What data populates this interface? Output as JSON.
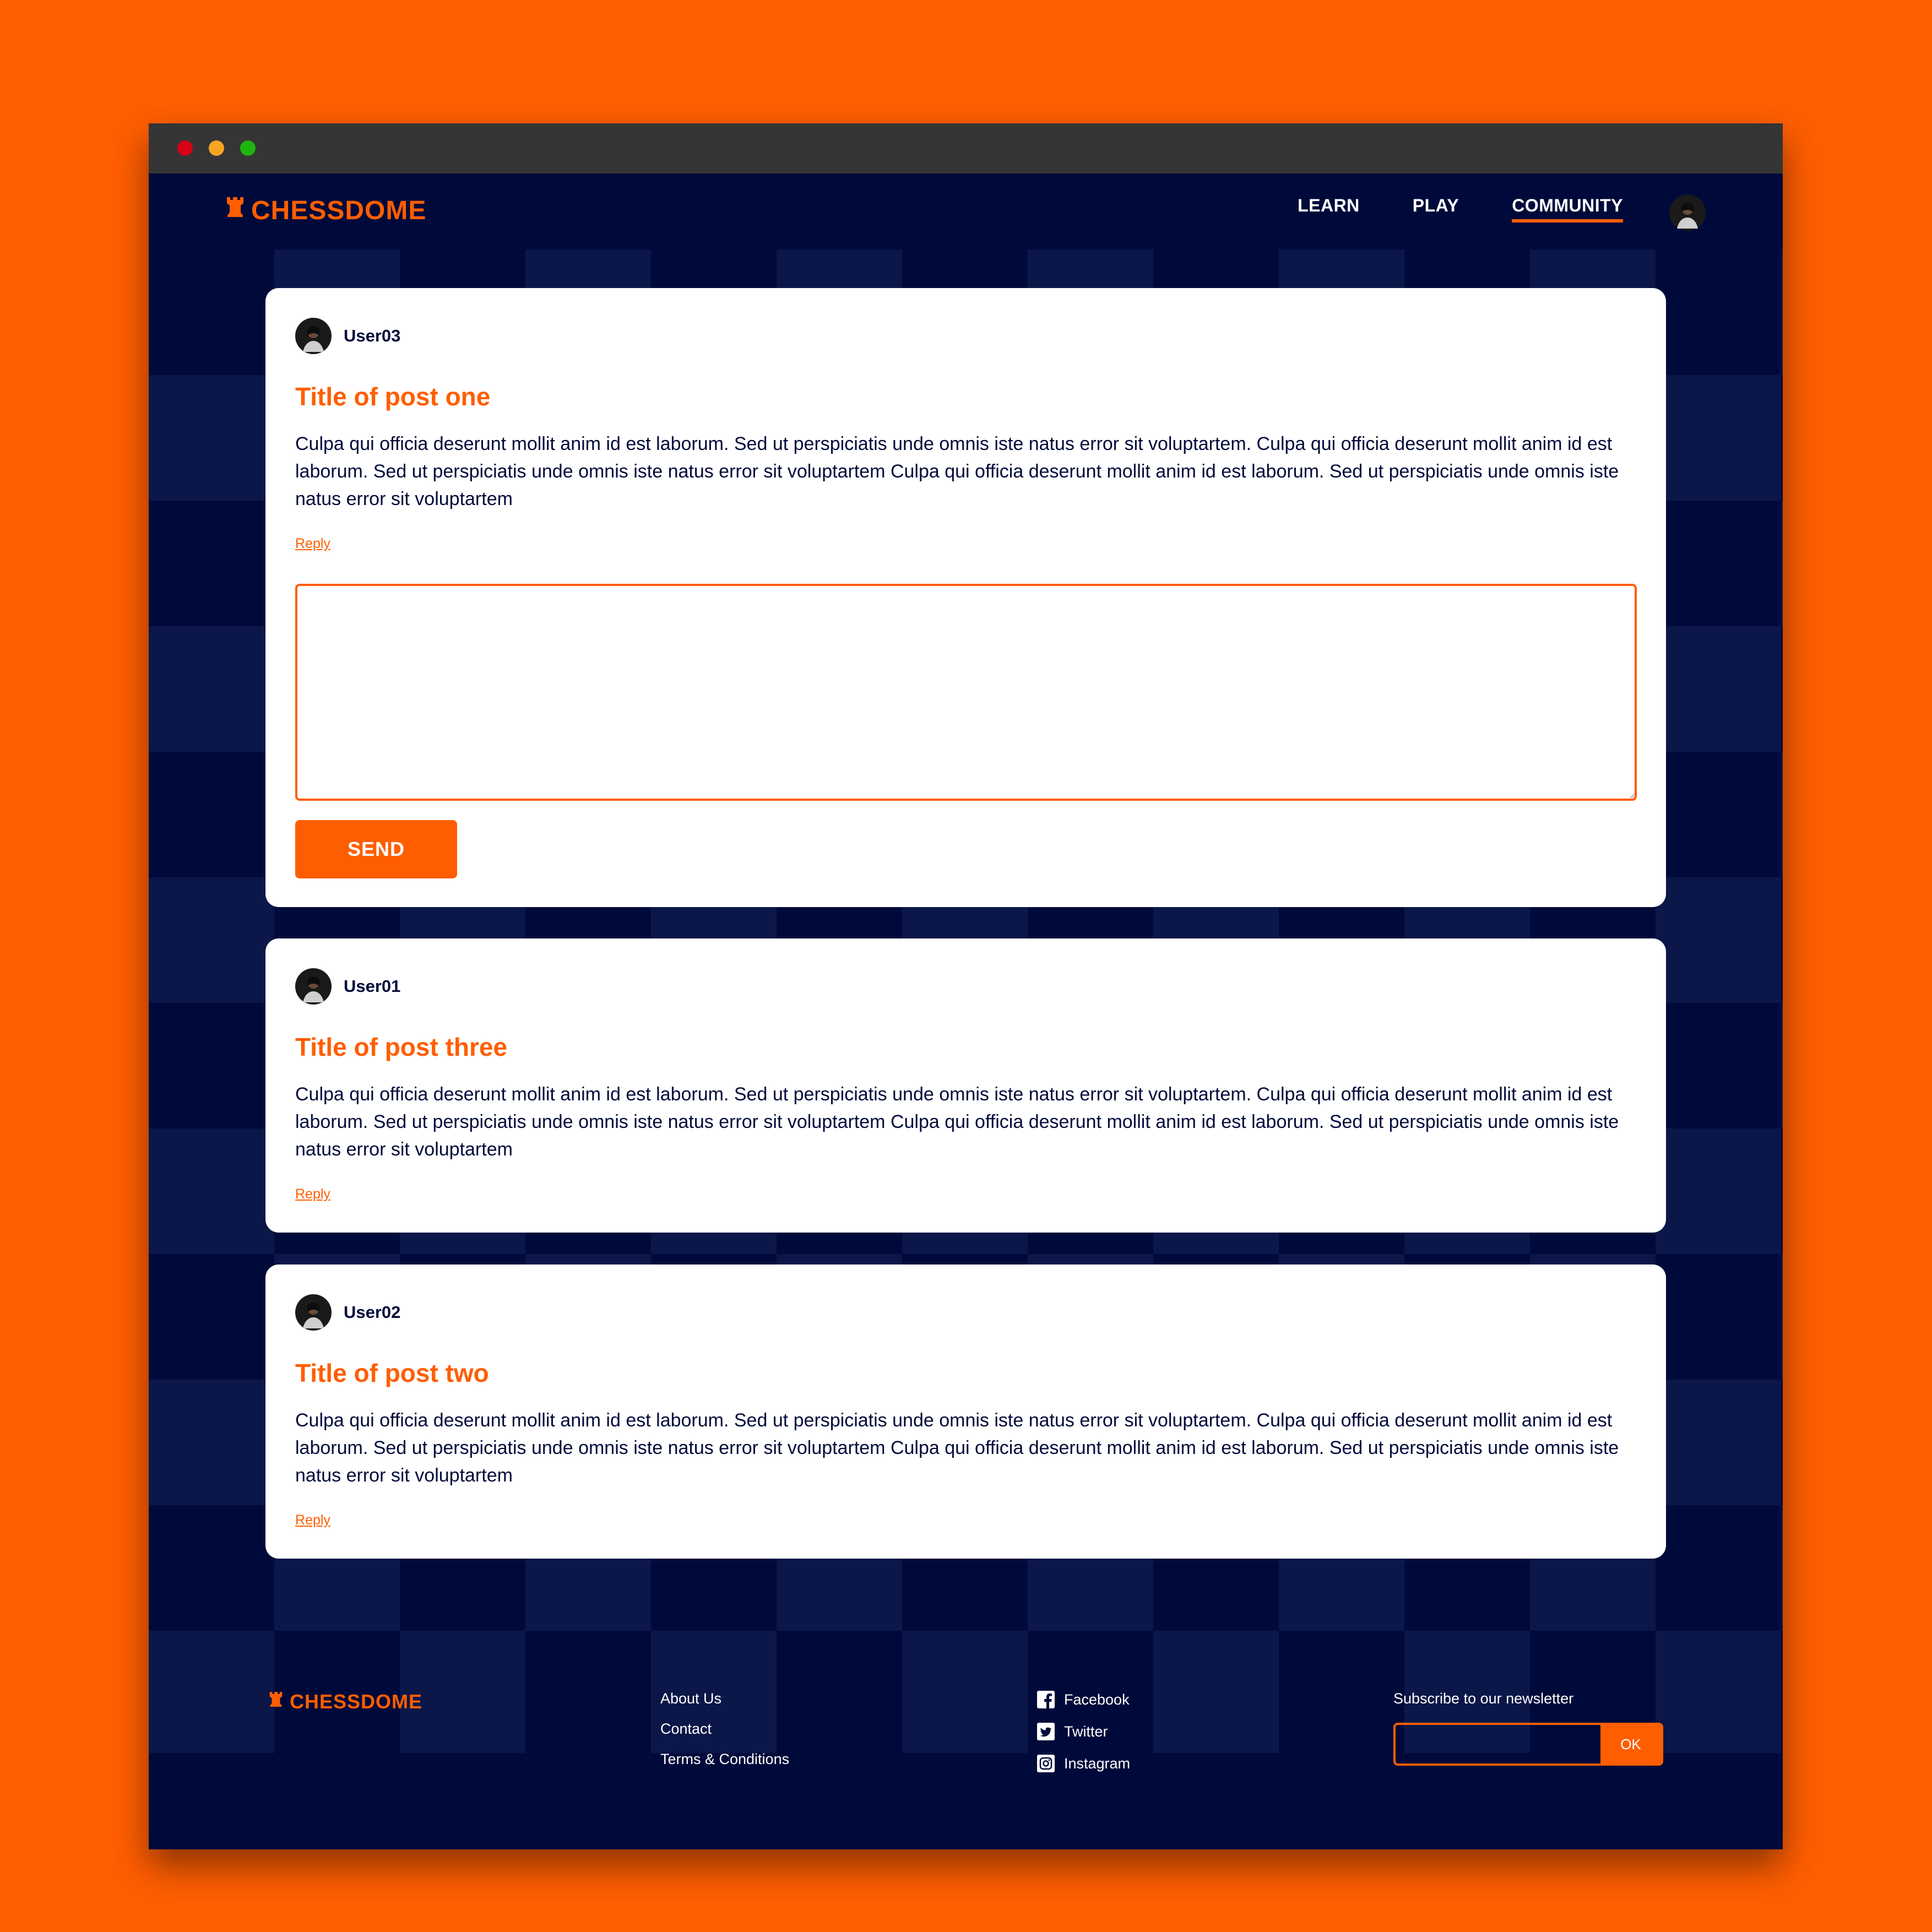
{
  "window": {
    "controls": [
      "close",
      "minimize",
      "maximize"
    ]
  },
  "colors": {
    "accent": "#ff5e00",
    "navy": "#000a3a",
    "checker_light": "#0b1748",
    "titlebar": "#353535"
  },
  "header": {
    "brand": "CHESSDOME",
    "brand_icon": "rook-icon",
    "nav": [
      {
        "label": "LEARN",
        "active": false
      },
      {
        "label": "PLAY",
        "active": false
      },
      {
        "label": "COMMUNITY",
        "active": true
      }
    ],
    "avatar_icon": "user-avatar"
  },
  "posts": [
    {
      "username": "User03",
      "title": "Title of post one",
      "body": "Culpa qui officia deserunt mollit anim id est laborum. Sed ut perspiciatis unde omnis iste natus error sit voluptartem. Culpa qui officia deserunt mollit anim id est laborum. Sed ut perspiciatis unde omnis iste natus error sit voluptartem Culpa qui officia deserunt mollit anim id est laborum. Sed ut perspiciatis unde omnis iste natus error sit voluptartem",
      "reply_label": "Reply",
      "reply_box": {
        "value": "",
        "placeholder": ""
      },
      "send_label": "SEND"
    },
    {
      "username": "User01",
      "title": "Title of post three",
      "body": "Culpa qui officia deserunt mollit anim id est laborum. Sed ut perspiciatis unde omnis iste natus error sit voluptartem. Culpa qui officia deserunt mollit anim id est laborum. Sed ut perspiciatis unde omnis iste natus error sit voluptartem Culpa qui officia deserunt mollit anim id est laborum. Sed ut perspiciatis unde omnis iste natus error sit voluptartem",
      "reply_label": "Reply"
    },
    {
      "username": "User02",
      "title": "Title of post two",
      "body": "Culpa qui officia deserunt mollit anim id est laborum. Sed ut perspiciatis unde omnis iste natus error sit voluptartem. Culpa qui officia deserunt mollit anim id est laborum. Sed ut perspiciatis unde omnis iste natus error sit voluptartem Culpa qui officia deserunt mollit anim id est laborum. Sed ut perspiciatis unde omnis iste natus error sit voluptartem",
      "reply_label": "Reply"
    }
  ],
  "footer": {
    "brand": "CHESSDOME",
    "links": [
      "About Us",
      "Contact",
      "Terms & Conditions"
    ],
    "social": [
      {
        "label": "Facebook",
        "icon": "facebook-icon"
      },
      {
        "label": "Twitter",
        "icon": "twitter-icon"
      },
      {
        "label": "Instagram",
        "icon": "instagram-icon"
      }
    ],
    "newsletter": {
      "label": "Subscribe to our newsletter",
      "input_value": "",
      "button_label": "OK"
    }
  }
}
